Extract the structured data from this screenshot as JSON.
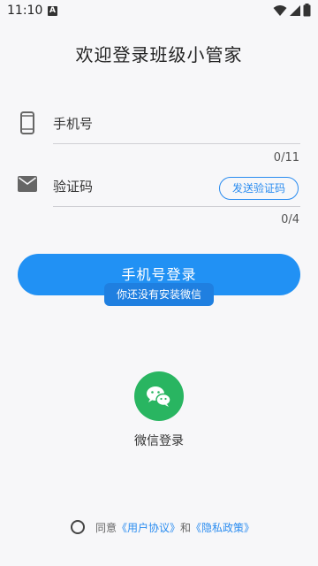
{
  "status_bar": {
    "time": "11:10",
    "notification_badge": "A",
    "icons": [
      "wifi-icon",
      "signal-icon",
      "battery-icon"
    ]
  },
  "title": "欢迎登录班级小管家",
  "phone": {
    "icon": "phone-icon",
    "placeholder": "手机号",
    "counter": "0/11"
  },
  "code": {
    "icon": "mail-icon",
    "placeholder": "验证码",
    "counter": "0/4",
    "send_button": "发送验证码"
  },
  "login_button": "手机号登录",
  "toast": "你还没有安装微信",
  "wechat": {
    "icon": "wechat-icon",
    "label": "微信登录"
  },
  "agreement": {
    "prefix": "同意",
    "user_agreement": "《用户协议》",
    "and": "和",
    "privacy_policy": "《隐私政策》"
  },
  "colors": {
    "accent": "#2191f4",
    "wechat": "#29b561",
    "background": "#f7f7f9"
  }
}
